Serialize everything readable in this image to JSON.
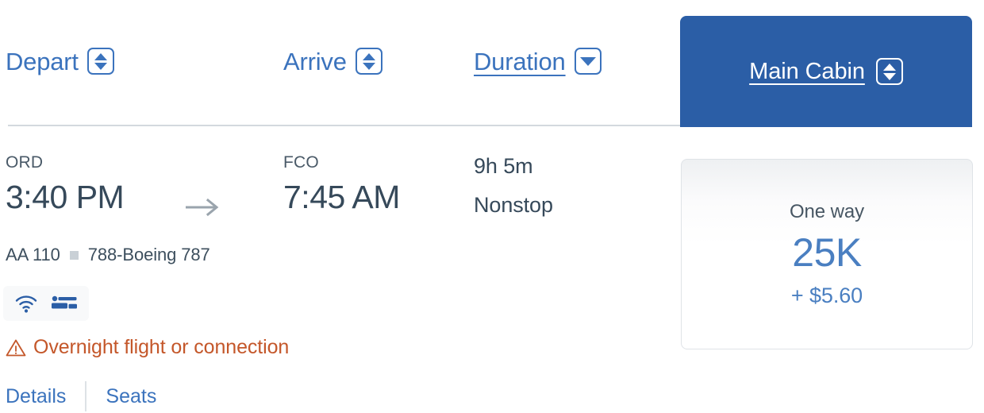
{
  "sort_header": {
    "columns": [
      {
        "label": "Depart",
        "icon": "sort-updown-icon",
        "active": false
      },
      {
        "label": "Arrive",
        "icon": "sort-updown-icon",
        "active": false
      },
      {
        "label": "Duration",
        "icon": "sort-down-icon",
        "active": true
      }
    ]
  },
  "cabin_tab": {
    "label": "Main Cabin",
    "icon": "sort-updown-icon",
    "selected": true,
    "background_color": "#2b5ea6"
  },
  "flight": {
    "depart": {
      "airport": "ORD",
      "time": "3:40 PM"
    },
    "arrive": {
      "airport": "FCO",
      "time": "7:45 AM"
    },
    "duration": "9h 5m",
    "stops": "Nonstop",
    "flight_number": "AA 110",
    "aircraft": "788-Boeing 787",
    "amenities": [
      {
        "name": "wifi-icon",
        "label": "Wi-Fi"
      },
      {
        "name": "lie-flat-seat-icon",
        "label": "Lie-flat seat"
      }
    ],
    "warning": {
      "icon": "warning-triangle-icon",
      "text": "Overnight flight or connection",
      "color": "#c4572a"
    },
    "links": [
      {
        "label": "Details"
      },
      {
        "label": "Seats"
      }
    ],
    "arrow_icon": "arrow-right-icon"
  },
  "price_card": {
    "trip_type": "One way",
    "miles": "25K",
    "fees": "+ $5.60",
    "accent_color": "#4a7fc1"
  }
}
